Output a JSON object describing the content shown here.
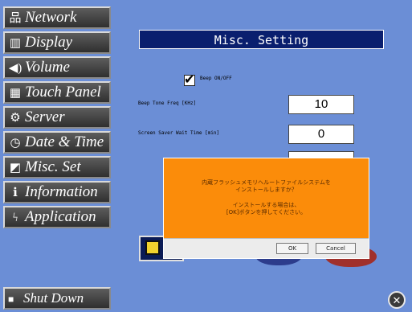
{
  "sidebar": {
    "items": [
      {
        "label": "Network",
        "icon": "network-icon",
        "glyph": "品"
      },
      {
        "label": "Display",
        "icon": "display-icon",
        "glyph": "▥"
      },
      {
        "label": "Volume",
        "icon": "volume-icon",
        "glyph": "◀)"
      },
      {
        "label": "Touch Panel",
        "icon": "touch-panel-icon",
        "glyph": "▦"
      },
      {
        "label": "Server",
        "icon": "server-icon",
        "glyph": "⚙"
      },
      {
        "label": "Date & Time",
        "icon": "clock-icon",
        "glyph": "◷"
      },
      {
        "label": "Misc. Set",
        "icon": "misc-set-icon",
        "glyph": "◩"
      },
      {
        "label": "Information",
        "icon": "information-icon",
        "glyph": "ℹ"
      },
      {
        "label": "Application",
        "icon": "application-icon",
        "glyph": "ϟ"
      }
    ],
    "shutdown_label": "Shut Down"
  },
  "panel": {
    "title": "Misc. Setting",
    "beep_label": "Beep ON/OFF",
    "beep_checked": true,
    "tone_freq_label": "Beep Tone Freq [KHz]",
    "tone_freq_value": "10",
    "screen_saver_label": "Screen Saver Wait Time [min]",
    "screen_saver_value": "0"
  },
  "dialog": {
    "message_line1": "内蔵フラッシュメモリへルートファイルシステムを",
    "message_line2": "インストールしますか？",
    "message_line3": "インストールする場合は、",
    "message_line4": "[OK]ボタンを押してください。",
    "ok_label": "OK",
    "cancel_label": "Cancel"
  },
  "colors": {
    "background": "#6b8ed6",
    "title_bar": "#0a1f6e",
    "dialog": "#fb8c0a",
    "sidebar_button": "#3a3a3a"
  }
}
